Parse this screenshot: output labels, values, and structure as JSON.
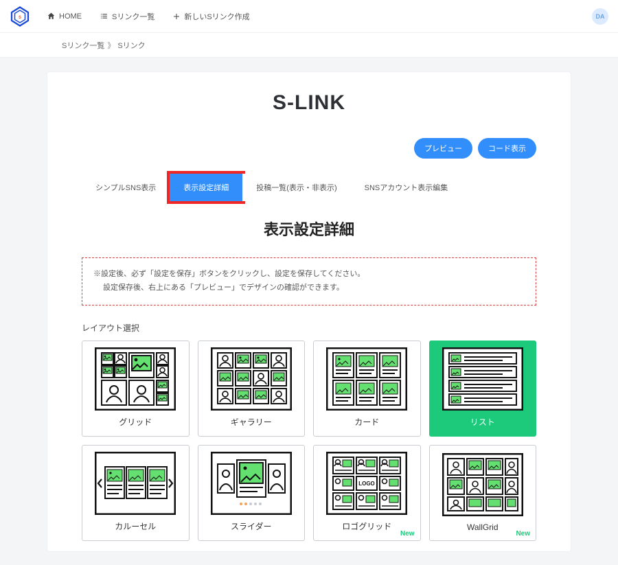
{
  "nav": {
    "home": "HOME",
    "list": "Sリンク一覧",
    "new": "新しいSリンク作成"
  },
  "avatar_initials": "DA",
  "breadcrumb": {
    "a": "Sリンク一覧",
    "sep": "》",
    "b": "Sリンク"
  },
  "title": "S-LINK",
  "buttons": {
    "preview": "プレビュー",
    "code": "コード表示"
  },
  "tabs": {
    "simple": "シンプルSNS表示",
    "detail": "表示設定詳細",
    "posts": "投稿一覧(表示・非表示)",
    "acct": "SNSアカウント表示編集",
    "active": "detail"
  },
  "section_heading": "表示設定詳細",
  "note": {
    "l1": "※設定後、必ず「設定を保存」ボタンをクリックし、設定を保存してください。",
    "l2": "設定保存後、右上にある「プレビュー」でデザインの確認ができます。"
  },
  "layout_label": "レイアウト選択",
  "layouts": [
    {
      "key": "grid",
      "label": "グリッド"
    },
    {
      "key": "gallery",
      "label": "ギャラリー"
    },
    {
      "key": "card",
      "label": "カード"
    },
    {
      "key": "list",
      "label": "リスト",
      "selected": true
    },
    {
      "key": "carousel",
      "label": "カルーセル"
    },
    {
      "key": "slider",
      "label": "スライダー"
    },
    {
      "key": "logogrid",
      "label": "ロゴグリッド",
      "badge": "New"
    },
    {
      "key": "wallgrid",
      "label": "WallGrid",
      "badge": "New"
    }
  ]
}
